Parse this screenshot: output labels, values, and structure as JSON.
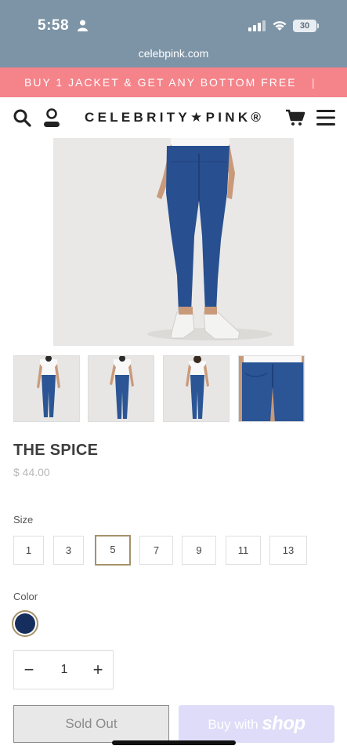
{
  "status_bar": {
    "time": "5:58",
    "battery": "30"
  },
  "browser": {
    "url": "celebpink.com"
  },
  "promo": {
    "text": "BUY 1 JACKET & GET ANY BOTTOM FREE",
    "separator": "|"
  },
  "header": {
    "logo": "CELEBRITY★PINK®",
    "icons": [
      "search-icon",
      "account-icon",
      "cart-icon",
      "menu-icon"
    ]
  },
  "product": {
    "title": "THE SPICE",
    "price": "$ 44.00",
    "size_label": "Size",
    "sizes": [
      "1",
      "3",
      "5",
      "7",
      "9",
      "11",
      "13"
    ],
    "selected_size": "5",
    "color_label": "Color",
    "color_swatch": "#152e5e",
    "quantity": "1",
    "qty_minus": "−",
    "qty_plus": "+",
    "sold_out_label": "Sold Out",
    "buy_with_label": "Buy with",
    "buy_with_brand": "shop"
  },
  "colors": {
    "status_bar": "#7d94a6",
    "promo": "#f5838a",
    "accent_gold": "#a4926a",
    "shop_pay": "#dedcf8"
  }
}
